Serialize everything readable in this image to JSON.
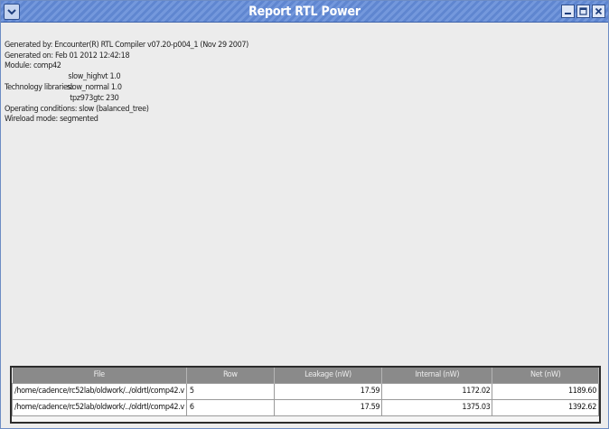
{
  "window": {
    "title": "Report RTL Power"
  },
  "header_info": {
    "generated_by": "Generated by:  Encounter(R) RTL Compiler v07.20-p004_1 (Nov 29 2007)",
    "generated_on": "Generated on:  Feb 01 2012 12:42:18",
    "module": "Module:  comp42",
    "technology_libraries_label": "Technology libraries:",
    "technology_libraries": [
      "slow_highvt 1.0",
      "slow_normal 1.0",
      "tpz973gtc 230"
    ],
    "operating_conditions": "Operating conditions:  slow (balanced_tree)",
    "wireload_mode": "Wireload mode:  segmented"
  },
  "table": {
    "columns": [
      "File",
      "Row",
      "Leakage (nW)",
      "Internal (nW)",
      "Net (nW)"
    ],
    "rows": [
      [
        "/home/cadence/rc52lab/oldwork/../oldrtl/comp42.v",
        "5",
        "17.59",
        "1172.02",
        "1189.60"
      ],
      [
        "/home/cadence/rc52lab/oldwork/../oldrtl/comp42.v",
        "6",
        "17.59",
        "1375.03",
        "1392.62"
      ]
    ]
  },
  "colors": {
    "titlebar": "#5f86d0",
    "header_bg": "#8a8a8a",
    "window_bg": "#ececec"
  }
}
